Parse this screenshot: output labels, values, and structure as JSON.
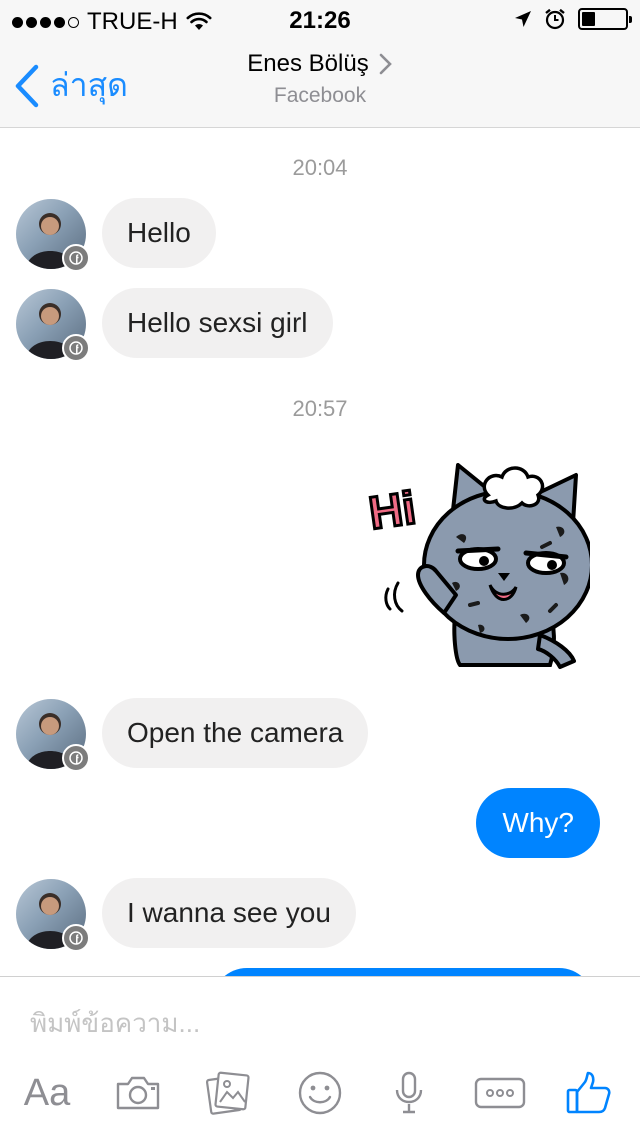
{
  "status_bar": {
    "carrier": "TRUE-H",
    "time": "21:26",
    "battery_level": 0.3
  },
  "nav": {
    "back_label": "ล่าสุด",
    "title": "Enes Bölüş",
    "subtitle": "Facebook"
  },
  "conversation": {
    "timestamps": [
      "20:04",
      "20:57"
    ],
    "messages": [
      {
        "direction": "incoming",
        "text": "Hello"
      },
      {
        "direction": "incoming",
        "text": "Hello sexsi girl"
      },
      {
        "direction": "outgoing",
        "type": "sticker",
        "sticker_text": "Hi"
      },
      {
        "direction": "incoming",
        "text": "Open the camera"
      },
      {
        "direction": "outgoing",
        "text": "Why?"
      },
      {
        "direction": "incoming",
        "text": "I wanna see you"
      }
    ]
  },
  "composer": {
    "placeholder": "พิมพ์ข้อความ...",
    "aa_label": "Aa"
  },
  "colors": {
    "accent": "#0084ff",
    "nav_accent": "#1a8cff",
    "incoming_bubble": "#f1f0f0",
    "muted": "#9b9b9b"
  },
  "icons": {
    "back": "chevron-left-icon",
    "camera": "camera-icon",
    "gallery": "gallery-icon",
    "emoji": "smiley-icon",
    "mic": "microphone-icon",
    "more": "more-icon",
    "like": "thumbs-up-icon"
  }
}
